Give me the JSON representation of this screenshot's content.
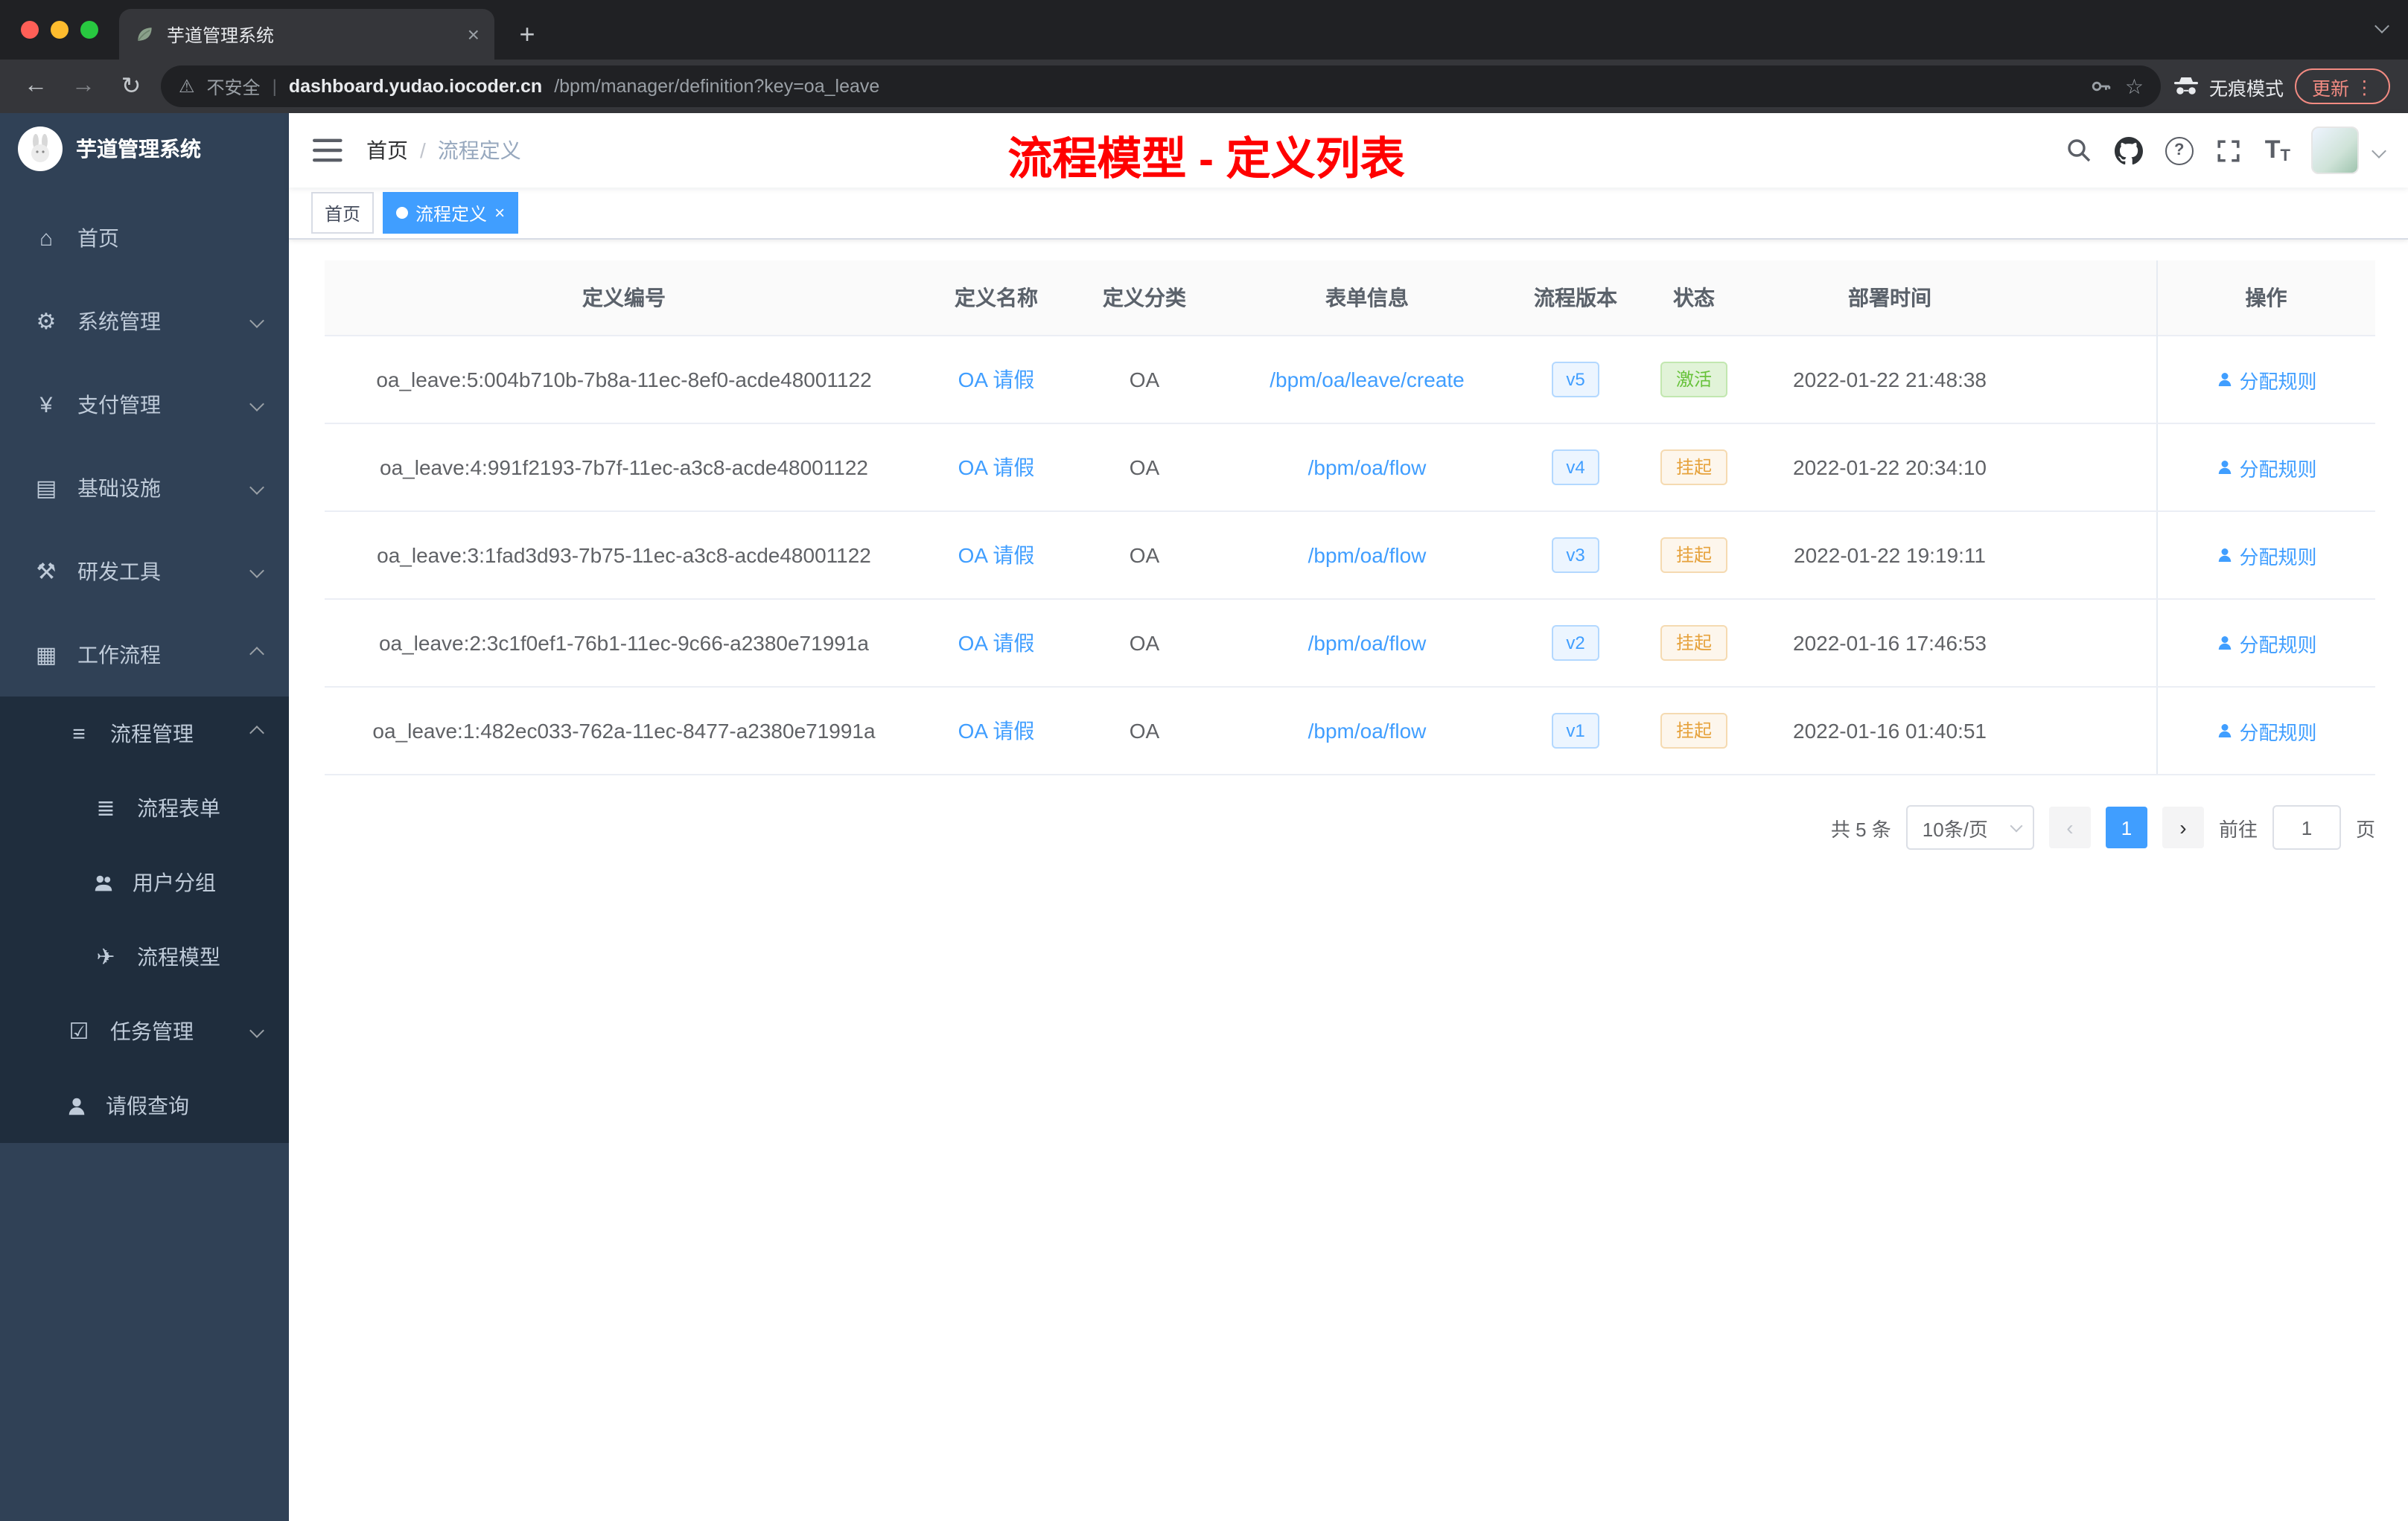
{
  "icons": {
    "plus": "+",
    "close": "×",
    "dots": "⋮",
    "star": "☆",
    "warning": "⚠",
    "back": "←",
    "forward": "→",
    "reload": "↻",
    "divider": "|",
    "question": "?",
    "size_big": "T",
    "size_small": "T"
  },
  "browser": {
    "tab_title": "芋道管理系统",
    "security_label": "不安全",
    "url_domain": "dashboard.yudao.iocoder.cn",
    "url_path": "/bpm/manager/definition?key=oa_leave",
    "incognito_label": "无痕模式",
    "update_label": "更新"
  },
  "sidebar": {
    "logo_title": "芋道管理系统",
    "items": [
      {
        "icon": "home-icon",
        "glyph": "⌂",
        "label": "首页"
      },
      {
        "icon": "gear-icon",
        "glyph": "⚙",
        "label": "系统管理",
        "expanded": false
      },
      {
        "icon": "yen-icon",
        "glyph": "¥",
        "label": "支付管理",
        "expanded": false
      },
      {
        "icon": "monitor-icon",
        "glyph": "▤",
        "label": "基础设施",
        "expanded": false
      },
      {
        "icon": "tools-icon",
        "glyph": "⚒",
        "label": "研发工具",
        "expanded": false
      },
      {
        "icon": "workflow-icon",
        "glyph": "▦",
        "label": "工作流程",
        "expanded": true
      },
      {
        "icon": "list-icon",
        "glyph": "≡",
        "label": "流程管理",
        "expanded": true
      },
      {
        "icon": "form-icon",
        "glyph": "≣",
        "label": "流程表单"
      },
      {
        "icon": "user-group-icon",
        "glyph": "",
        "label": "用户分组"
      },
      {
        "icon": "send-icon",
        "glyph": "✈",
        "label": "流程模型"
      },
      {
        "icon": "task-icon",
        "glyph": "☑",
        "label": "任务管理",
        "expanded": false
      },
      {
        "icon": "person-icon",
        "glyph": "",
        "label": "请假查询"
      }
    ]
  },
  "header": {
    "breadcrumb_home": "首页",
    "breadcrumb_sep": "/",
    "breadcrumb_current": "流程定义",
    "annotation": "流程模型 - 定义列表"
  },
  "tags": {
    "home": "首页",
    "active": "流程定义",
    "close": "×"
  },
  "table": {
    "columns": [
      "定义编号",
      "定义名称",
      "定义分类",
      "表单信息",
      "流程版本",
      "状态",
      "部署时间",
      "操作"
    ],
    "rows": [
      {
        "id": "oa_leave:5:004b710b-7b8a-11ec-8ef0-acde48001122",
        "name": "OA 请假",
        "category": "OA",
        "form": "/bpm/oa/leave/create",
        "version": "v5",
        "status": "激活",
        "status_type": "success",
        "time": "2022-01-22 21:48:38",
        "action": "分配规则"
      },
      {
        "id": "oa_leave:4:991f2193-7b7f-11ec-a3c8-acde48001122",
        "name": "OA 请假",
        "category": "OA",
        "form": "/bpm/oa/flow",
        "version": "v4",
        "status": "挂起",
        "status_type": "warning",
        "time": "2022-01-22 20:34:10",
        "action": "分配规则"
      },
      {
        "id": "oa_leave:3:1fad3d93-7b75-11ec-a3c8-acde48001122",
        "name": "OA 请假",
        "category": "OA",
        "form": "/bpm/oa/flow",
        "version": "v3",
        "status": "挂起",
        "status_type": "warning",
        "time": "2022-01-22 19:19:11",
        "action": "分配规则"
      },
      {
        "id": "oa_leave:2:3c1f0ef1-76b1-11ec-9c66-a2380e71991a",
        "name": "OA 请假",
        "category": "OA",
        "form": "/bpm/oa/flow",
        "version": "v2",
        "status": "挂起",
        "status_type": "warning",
        "time": "2022-01-16 17:46:53",
        "action": "分配规则"
      },
      {
        "id": "oa_leave:1:482ec033-762a-11ec-8477-a2380e71991a",
        "name": "OA 请假",
        "category": "OA",
        "form": "/bpm/oa/flow",
        "version": "v1",
        "status": "挂起",
        "status_type": "warning",
        "time": "2022-01-16 01:40:51",
        "action": "分配规则"
      }
    ]
  },
  "pagination": {
    "total": "共 5 条",
    "page_size": "10条/页",
    "prev": "‹",
    "page": "1",
    "next": "›",
    "goto": "前往",
    "goto_value": "1",
    "unit": "页"
  }
}
